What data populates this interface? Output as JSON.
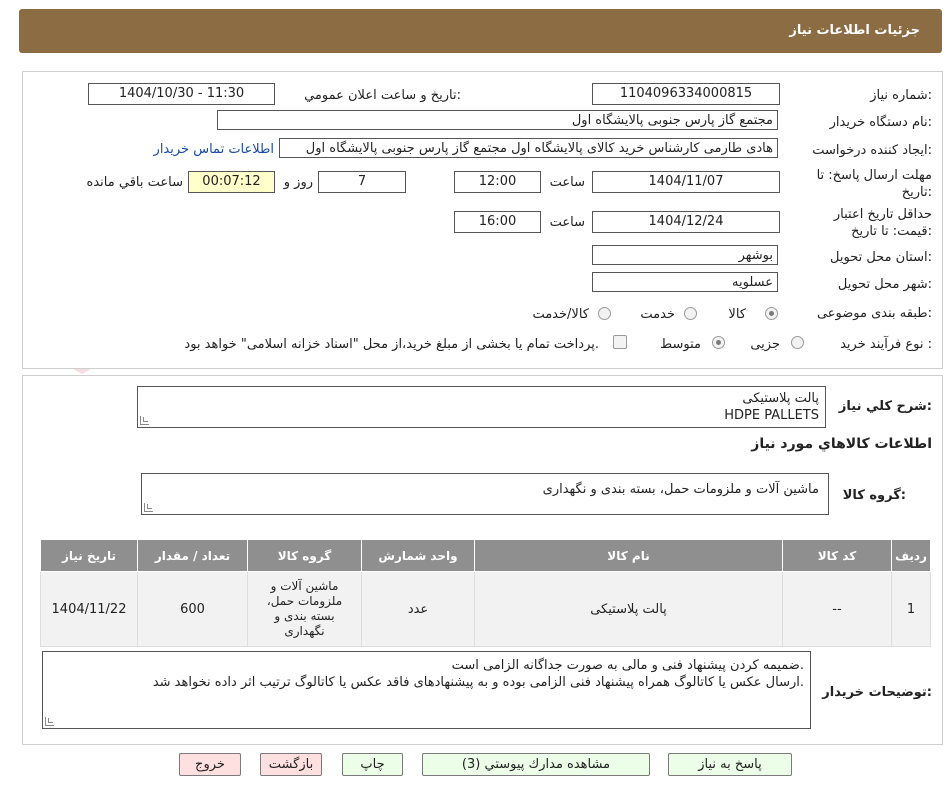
{
  "header": {
    "title": "جزئیات اطلاعات نیاز"
  },
  "watermark": {
    "text": "AriaTender.neT"
  },
  "form": {
    "need_number_label": "شماره نیاز:",
    "need_number": "1104096334000815",
    "announce_label": "تاریخ و ساعت اعلان عمومي:",
    "announce_value": "1404/10/30 - 11:30",
    "buyer_label": "نام دستگاه خریدار:",
    "buyer_value": "مجتمع گاز پارس جنوبی  پالایشگاه اول",
    "creator_label": "ایجاد کننده درخواست:",
    "creator_value": "هادی طارمی کارشناس خرید کالای پالایشگاه اول مجتمع گاز پارس جنوبی  پالایشگاه اول",
    "contact_link": "اطلاعات تماس خریدار",
    "deadline_label_1": "مهلت ارسال پاسخ: تا",
    "deadline_label_2": "تاریخ:",
    "deadline_date": "1404/11/07",
    "time_label": "ساعت",
    "deadline_time": "12:00",
    "days_value": "7",
    "days_label": "روز و",
    "timer_value": "00:07:12",
    "remaining_label": "ساعت باقي مانده",
    "validity_label_1": "حداقل تاریخ اعتبار",
    "validity_label_2": "قیمت: تا تاریخ:",
    "validity_date": "1404/12/24",
    "validity_time": "16:00",
    "province_label": "استان محل تحویل:",
    "province_value": "بوشهر",
    "city_label": "شهر محل تحویل:",
    "city_value": "عسلویه",
    "category_label": "طبقه بندی موضوعی:",
    "category_options": [
      "کالا",
      "خدمت",
      "کالا/خدمت"
    ],
    "process_label": "نوع فرآیند خرید :",
    "process_options": [
      "جزیی",
      "متوسط"
    ],
    "payment_note": "پرداخت تمام یا بخشی از مبلغ خرید،از محل \"اسناد خزانه اسلامی\" خواهد بود."
  },
  "details": {
    "summary_label": "شرح کلي نیاز:",
    "summary_line1": "پالت پلاستیکی",
    "summary_line2": "HDPE PALLETS",
    "items_title": "اطلاعات کالاهاي مورد نیاز",
    "group_label": "گروه کالا:",
    "group_value": "ماشین آلات و ملزومات حمل، بسته بندی و نگهداری",
    "table": {
      "headers": [
        "ردیف",
        "کد کالا",
        "نام کالا",
        "واحد شمارش",
        "گروه کالا",
        "تعداد / مقدار",
        "تاریخ نیاز"
      ],
      "rows": [
        [
          "1",
          "--",
          "پالت پلاستیکی",
          "عدد",
          "ماشین آلات و ملزومات حمل، بسته بندی و نگهداری",
          "600",
          "1404/11/22"
        ]
      ]
    },
    "notes_label": "توضیحات خریدار:",
    "notes_line1": "ضمیمه کردن پیشنهاد فنی و مالی به صورت جداگانه الزامی است.",
    "notes_line2": "ارسال عکس یا کاتالوگ همراه پیشنهاد فنی الزامی بوده و به پیشنهادهای فاقد عکس یا کاتالوگ ترتیب اثر داده نخواهد شد."
  },
  "buttons": {
    "reply": "پاسخ به نیاز",
    "attachments": "مشاهده مدارك پیوستي (3)",
    "print": "چاپ",
    "back": "بازگشت",
    "exit": "خروج"
  }
}
